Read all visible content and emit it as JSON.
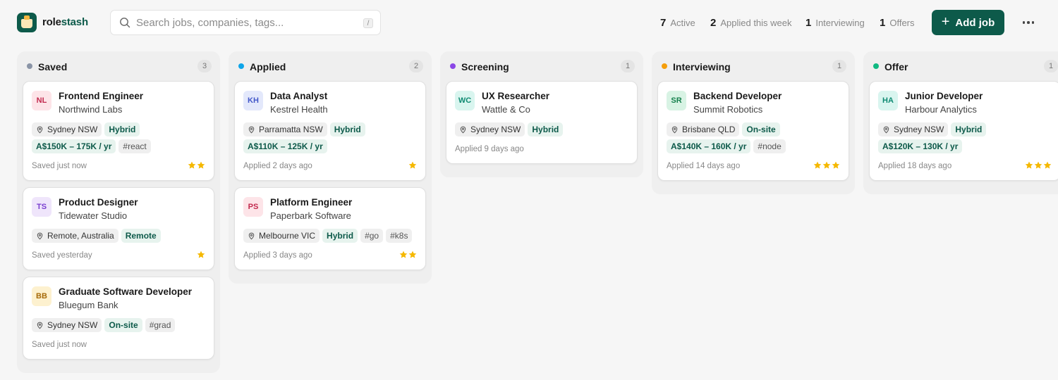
{
  "app": {
    "brand_part1": "role",
    "brand_part2": "stash"
  },
  "search": {
    "placeholder": "Search jobs, companies, tags...",
    "shortcut": "/"
  },
  "stats": [
    {
      "value": "7",
      "label": "Active"
    },
    {
      "value": "2",
      "label": "Applied this week"
    },
    {
      "value": "1",
      "label": "Interviewing"
    },
    {
      "value": "1",
      "label": "Offers"
    }
  ],
  "actions": {
    "add_label": "Add job",
    "add_icon": "+"
  },
  "colors": {
    "brand": "#0d5a4a",
    "saved": "#8a94a6",
    "applied": "#0ea5e9",
    "screening": "#8b47e6",
    "interviewing": "#f59e0b",
    "offer": "#10b981",
    "star": "#f5b800"
  },
  "columns": [
    {
      "title": "Saved",
      "count": "3",
      "dot": "#8a94a6",
      "cards": [
        {
          "initials": "NL",
          "avatar_bg": "#fde4e8",
          "avatar_fg": "#c22a4e",
          "role": "Frontend Engineer",
          "company": "Northwind Labs",
          "location": "Sydney NSW",
          "mode": "Hybrid",
          "salary": "A$150K – 175K / yr",
          "tags": [
            "#react"
          ],
          "status": "Saved just now",
          "stars": 2
        },
        {
          "initials": "TS",
          "avatar_bg": "#efe5fb",
          "avatar_fg": "#7a3fd0",
          "role": "Product Designer",
          "company": "Tidewater Studio",
          "location": "Remote, Australia",
          "mode": "Remote",
          "salary": "",
          "tags": [],
          "status": "Saved yesterday",
          "stars": 1
        },
        {
          "initials": "BB",
          "avatar_bg": "#fdf1cf",
          "avatar_fg": "#a66a0a",
          "role": "Graduate Software Developer",
          "company": "Bluegum Bank",
          "location": "Sydney NSW",
          "mode": "On-site",
          "salary": "",
          "tags": [
            "#grad"
          ],
          "status": "Saved just now",
          "stars": 0
        }
      ]
    },
    {
      "title": "Applied",
      "count": "2",
      "dot": "#0ea5e9",
      "cards": [
        {
          "initials": "KH",
          "avatar_bg": "#e3e8fb",
          "avatar_fg": "#4257c8",
          "role": "Data Analyst",
          "company": "Kestrel Health",
          "location": "Parramatta NSW",
          "mode": "Hybrid",
          "salary": "A$110K – 125K / yr",
          "tags": [],
          "status": "Applied 2 days ago",
          "stars": 1
        },
        {
          "initials": "PS",
          "avatar_bg": "#fde4e8",
          "avatar_fg": "#c22a4e",
          "role": "Platform Engineer",
          "company": "Paperbark Software",
          "location": "Melbourne VIC",
          "mode": "Hybrid",
          "salary": "",
          "tags": [
            "#go",
            "#k8s"
          ],
          "status": "Applied 3 days ago",
          "stars": 2
        }
      ]
    },
    {
      "title": "Screening",
      "count": "1",
      "dot": "#8b47e6",
      "cards": [
        {
          "initials": "WC",
          "avatar_bg": "#d9f5ef",
          "avatar_fg": "#0f8a72",
          "role": "UX Researcher",
          "company": "Wattle & Co",
          "location": "Sydney NSW",
          "mode": "Hybrid",
          "salary": "",
          "tags": [],
          "status": "Applied 9 days ago",
          "stars": 0
        }
      ]
    },
    {
      "title": "Interviewing",
      "count": "1",
      "dot": "#f59e0b",
      "cards": [
        {
          "initials": "SR",
          "avatar_bg": "#d8f3e4",
          "avatar_fg": "#16804d",
          "role": "Backend Developer",
          "company": "Summit Robotics",
          "location": "Brisbane QLD",
          "mode": "On-site",
          "salary": "A$140K – 160K / yr",
          "tags": [
            "#node"
          ],
          "status": "Applied 14 days ago",
          "stars": 3
        }
      ]
    },
    {
      "title": "Offer",
      "count": "1",
      "dot": "#10b981",
      "cards": [
        {
          "initials": "HA",
          "avatar_bg": "#d9f5ef",
          "avatar_fg": "#0f8a72",
          "role": "Junior Developer",
          "company": "Harbour Analytics",
          "location": "Sydney NSW",
          "mode": "Hybrid",
          "salary": "A$120K – 130K / yr",
          "tags": [],
          "status": "Applied 18 days ago",
          "stars": 3
        }
      ]
    }
  ]
}
